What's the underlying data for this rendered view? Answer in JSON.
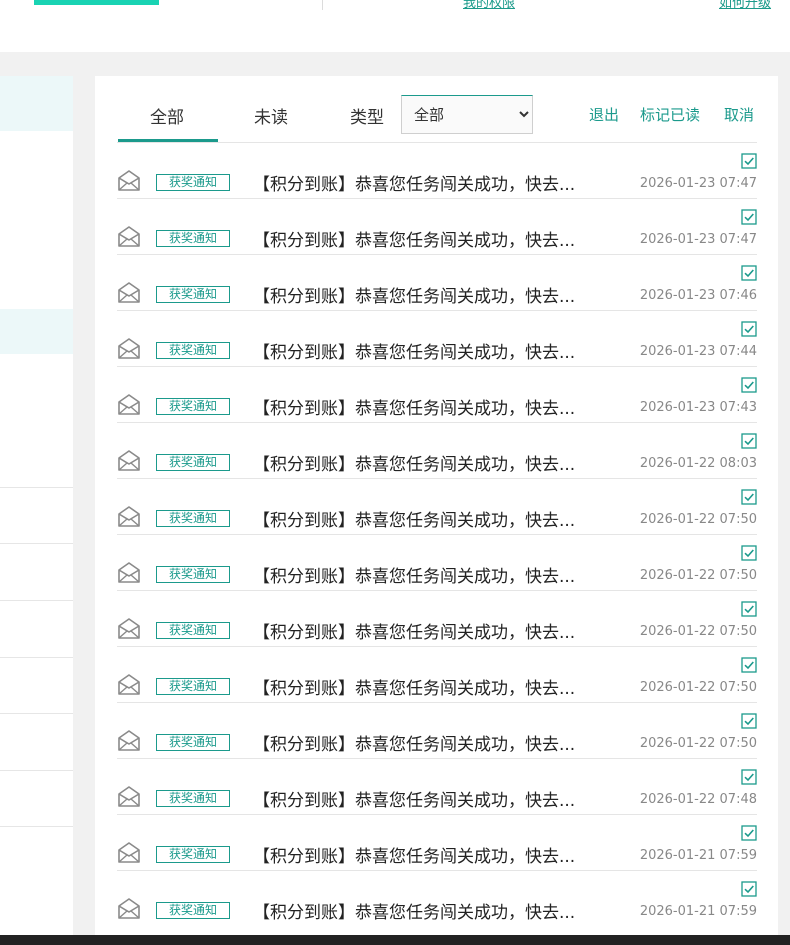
{
  "header": {
    "links": {
      "mine": "我的权限",
      "upgrade": "如何升级"
    }
  },
  "tabs": {
    "all": "全部",
    "unread": "未读"
  },
  "filter": {
    "label": "类型",
    "selected": "全部"
  },
  "actions": {
    "exit": "退出",
    "mark_read": "标记已读",
    "cancel": "取消"
  },
  "messages": [
    {
      "badge": "获奖通知",
      "title": "【积分到账】恭喜您任务闯关成功，快去...",
      "date": "2026-01-23 07:47",
      "checked": true
    },
    {
      "badge": "获奖通知",
      "title": "【积分到账】恭喜您任务闯关成功，快去...",
      "date": "2026-01-23 07:47",
      "checked": true
    },
    {
      "badge": "获奖通知",
      "title": "【积分到账】恭喜您任务闯关成功，快去...",
      "date": "2026-01-23 07:46",
      "checked": true
    },
    {
      "badge": "获奖通知",
      "title": "【积分到账】恭喜您任务闯关成功，快去...",
      "date": "2026-01-23 07:44",
      "checked": true
    },
    {
      "badge": "获奖通知",
      "title": "【积分到账】恭喜您任务闯关成功，快去...",
      "date": "2026-01-23 07:43",
      "checked": true
    },
    {
      "badge": "获奖通知",
      "title": "【积分到账】恭喜您任务闯关成功，快去...",
      "date": "2026-01-22 08:03",
      "checked": true
    },
    {
      "badge": "获奖通知",
      "title": "【积分到账】恭喜您任务闯关成功，快去...",
      "date": "2026-01-22 07:50",
      "checked": true
    },
    {
      "badge": "获奖通知",
      "title": "【积分到账】恭喜您任务闯关成功，快去...",
      "date": "2026-01-22 07:50",
      "checked": true
    },
    {
      "badge": "获奖通知",
      "title": "【积分到账】恭喜您任务闯关成功，快去...",
      "date": "2026-01-22 07:50",
      "checked": true
    },
    {
      "badge": "获奖通知",
      "title": "【积分到账】恭喜您任务闯关成功，快去...",
      "date": "2026-01-22 07:50",
      "checked": true
    },
    {
      "badge": "获奖通知",
      "title": "【积分到账】恭喜您任务闯关成功，快去...",
      "date": "2026-01-22 07:50",
      "checked": true
    },
    {
      "badge": "获奖通知",
      "title": "【积分到账】恭喜您任务闯关成功，快去...",
      "date": "2026-01-22 07:48",
      "checked": true
    },
    {
      "badge": "获奖通知",
      "title": "【积分到账】恭喜您任务闯关成功，快去...",
      "date": "2026-01-21 07:59",
      "checked": true
    },
    {
      "badge": "获奖通知",
      "title": "【积分到账】恭喜您任务闯关成功，快去...",
      "date": "2026-01-21 07:59",
      "checked": true
    }
  ],
  "icons": {
    "message": "envelope-icon",
    "select": "checkbox-icon"
  },
  "colors": {
    "accent": "#1b9a8c",
    "brand_bar": "#19d3b3"
  }
}
